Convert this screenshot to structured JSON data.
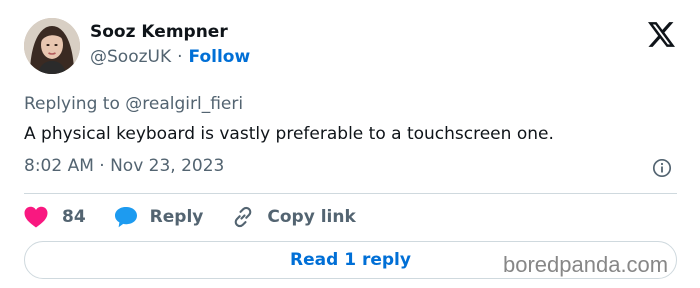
{
  "author": {
    "name": "Sooz Kempner",
    "handle": "@SoozUK",
    "separator": "·",
    "follow_label": "Follow"
  },
  "tweet": {
    "reply_prefix": "Replying to ",
    "reply_to": "@realgirl_fieri",
    "text": "A physical keyboard is vastly preferable to a touchscreen one.",
    "timestamp": "8:02 AM · Nov 23, 2023"
  },
  "actions": {
    "likes_count": "84",
    "reply_label": "Reply",
    "copy_link_label": "Copy link"
  },
  "read_replies_label": "Read 1 reply",
  "watermark": "boredpanda.com",
  "icons": {
    "platform": "x-logo-icon",
    "like": "heart-icon",
    "reply": "speech-bubble-icon",
    "copy": "link-icon",
    "info": "info-icon"
  },
  "colors": {
    "like": "#f91880",
    "reply": "#1d9bf0",
    "link_accent": "#006fd6",
    "muted": "#536471"
  }
}
